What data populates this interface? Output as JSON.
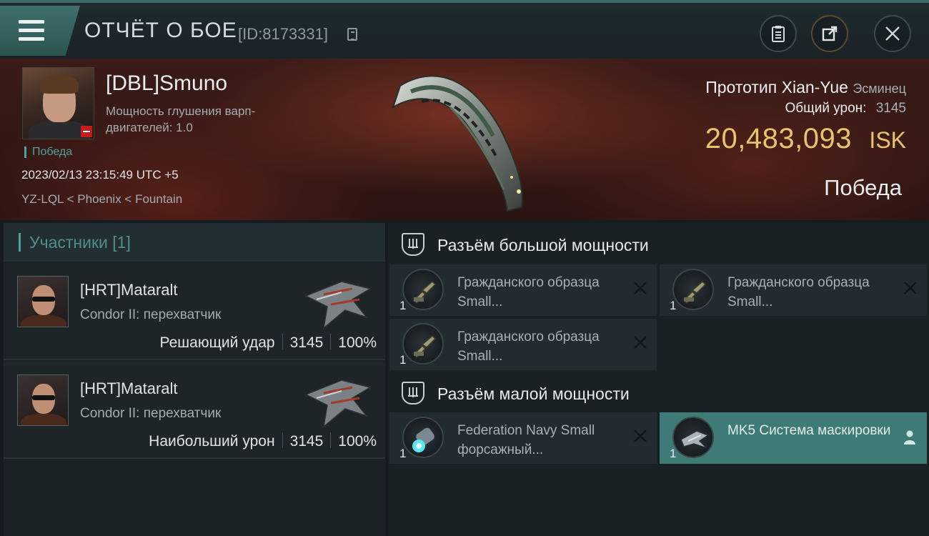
{
  "header": {
    "title": "ОТЧЁТ О БОЕ",
    "report_id": "[ID:8173331]"
  },
  "victim": {
    "name": "[DBL]Smuno",
    "warp_label": "Мощность глушения варп-двигателей: 1.0",
    "status": "Победа",
    "timestamp": "2023/02/13 23:15:49 UTC +5",
    "location": "YZ-LQL < Phoenix < Fountain"
  },
  "ship": {
    "name": "Прототип Xian-Yue",
    "class": "Эсминец",
    "damage_label": "Общий урон:",
    "damage_value": "3145",
    "isk_value": "20,483,093",
    "isk_unit": "ISK",
    "result": "Победа"
  },
  "participants": {
    "header": "Участники [1]",
    "items": [
      {
        "name": "[HRT]Mataralt",
        "ship": "Condor II: перехватчик",
        "role": "Решающий удар",
        "damage": "3145",
        "percent": "100%"
      },
      {
        "name": "[HRT]Mataralt",
        "ship": "Condor II: перехватчик",
        "role": "Наибольший урон",
        "damage": "3145",
        "percent": "100%"
      }
    ]
  },
  "slots": {
    "high": {
      "title": "Разъём большой мощности",
      "modules": [
        {
          "name": "Гражданского образца Small...",
          "qty": "1"
        },
        {
          "name": "Гражданского образца Small...",
          "qty": "1"
        },
        {
          "name": "Гражданского образца Small...",
          "qty": "1"
        }
      ]
    },
    "low": {
      "title": "Разъём малой мощности",
      "modules": [
        {
          "name": "Federation Navy Small форсажный...",
          "qty": "1"
        },
        {
          "name": "MK5 Система маскировки",
          "qty": "1"
        }
      ]
    }
  },
  "colors": {
    "accent": "#4fa19b",
    "isk": "#e9c46a",
    "selected_module": "#3e7b77",
    "header_tab": "#3f6f6c"
  },
  "icons": {
    "menu": "hamburger-icon",
    "copy": "copy-icon",
    "clipboard": "clipboard-icon",
    "share": "share-icon",
    "close": "close-icon",
    "slot": "slot-shield-icon",
    "remove": "x-icon",
    "person": "person-icon"
  }
}
